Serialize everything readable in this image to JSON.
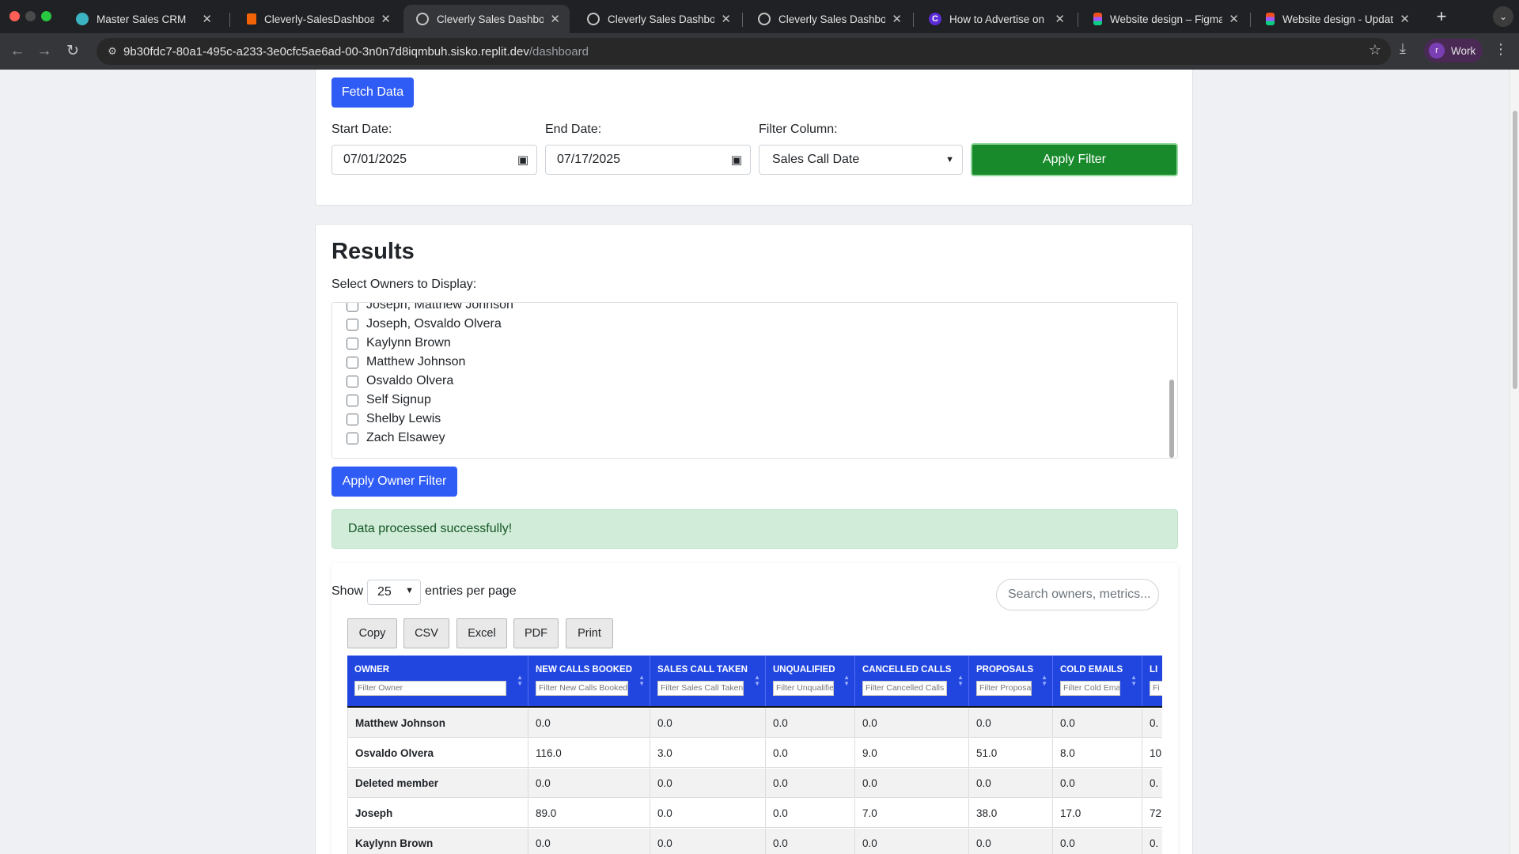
{
  "browser": {
    "tabs": [
      {
        "title": "Master Sales CRM",
        "icon": "crm-logo-icon"
      },
      {
        "title": "Cleverly-SalesDashboard",
        "icon": "replit-icon"
      },
      {
        "title": "Cleverly Sales Dashboard",
        "icon": "globe-icon",
        "active": true
      },
      {
        "title": "Cleverly Sales Dashboard",
        "icon": "globe-icon"
      },
      {
        "title": "Cleverly Sales Dashboard",
        "icon": "globe-icon"
      },
      {
        "title": "How to Advertise on LinkedIn",
        "icon": "canva-icon"
      },
      {
        "title": "Website design – Figma",
        "icon": "figma-icon"
      },
      {
        "title": "Website design - Updated",
        "icon": "figma-icon"
      }
    ],
    "url_host": "9b30fdc7-80a1-495c-a233-3e0cfc5ae6ad-00-3n0n7d8iqmbuh.sisko.replit.dev",
    "url_path": "/dashboard",
    "profile_initial": "r",
    "profile_label": "Work"
  },
  "filters": {
    "fetch_label": "Fetch Data",
    "start_label": "Start Date:",
    "start_value": "07/01/2025",
    "end_label": "End Date:",
    "end_value": "07/17/2025",
    "column_label": "Filter Column:",
    "column_value": "Sales Call Date",
    "apply_label": "Apply Filter"
  },
  "results": {
    "heading": "Results",
    "owners_label": "Select Owners to Display:",
    "owners": [
      "Joseph, Matthew Johnson",
      "Joseph, Osvaldo Olvera",
      "Kaylynn Brown",
      "Matthew Johnson",
      "Osvaldo Olvera",
      "Self Signup",
      "Shelby Lewis",
      "Zach Elsawey"
    ],
    "apply_owner_label": "Apply Owner Filter",
    "alert": "Data processed successfully!"
  },
  "table": {
    "show_label": "Show",
    "page_size": "25",
    "entries_label": "entries per page",
    "search_placeholder": "Search owners, metrics...",
    "buttons": [
      "Copy",
      "CSV",
      "Excel",
      "PDF",
      "Print"
    ],
    "columns": [
      {
        "title": "OWNER",
        "filter": "Filter Owner"
      },
      {
        "title": "NEW CALLS BOOKED",
        "filter": "Filter New Calls Booked"
      },
      {
        "title": "SALES CALL TAKEN",
        "filter": "Filter Sales Call Taken"
      },
      {
        "title": "UNQUALIFIED",
        "filter": "Filter Unqualified"
      },
      {
        "title": "CANCELLED CALLS",
        "filter": "Filter Cancelled Calls"
      },
      {
        "title": "PROPOSALS",
        "filter": "Filter Proposals"
      },
      {
        "title": "COLD EMAILS",
        "filter": "Filter Cold Emails"
      },
      {
        "title": "LI",
        "filter": "Fi"
      }
    ],
    "rows": [
      [
        "Matthew Johnson",
        "0.0",
        "0.0",
        "0.0",
        "0.0",
        "0.0",
        "0.0",
        "0."
      ],
      [
        "Osvaldo Olvera",
        "116.0",
        "3.0",
        "0.0",
        "9.0",
        "51.0",
        "8.0",
        "10"
      ],
      [
        "Deleted member",
        "0.0",
        "0.0",
        "0.0",
        "0.0",
        "0.0",
        "0.0",
        "0."
      ],
      [
        "Joseph",
        "89.0",
        "0.0",
        "0.0",
        "7.0",
        "38.0",
        "17.0",
        "72"
      ],
      [
        "Kaylynn Brown",
        "0.0",
        "0.0",
        "0.0",
        "0.0",
        "0.0",
        "0.0",
        "0."
      ]
    ]
  },
  "colors": {
    "primary": "#2f5cf5",
    "success": "#198a2c",
    "table_header": "#2146e0",
    "alert_bg": "#d1ecd9"
  }
}
